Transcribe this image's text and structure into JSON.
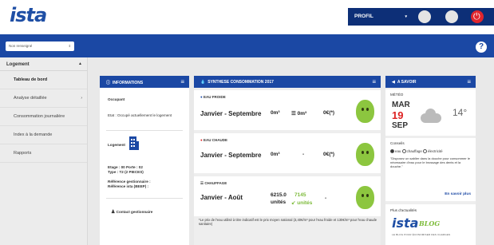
{
  "header": {
    "logo": "ista",
    "profile_label": "PROFIL",
    "profile_caret": "▾"
  },
  "blueband": {
    "select_value": "Non renseigné",
    "help": "?"
  },
  "sidebar": {
    "section": "Logement",
    "items": [
      {
        "label": "Tableau de bord"
      },
      {
        "label": "Analyse détaillée"
      },
      {
        "label": "Consommation journalière"
      },
      {
        "label": "Index à la demande"
      },
      {
        "label": "Rapports"
      }
    ]
  },
  "informations": {
    "title": "INFORMATIONS",
    "occupant_label": "Occupant",
    "etat": "Etat : Occupé actuellement le logement",
    "logement_label": "Logement",
    "etage": "Etage : 00  Porte : 02",
    "type": "Type : T2 (2 PIECES)",
    "ref_gest": "Référence gestionnaire :",
    "ref_ista": "Référence ista (BEEP) :",
    "contact": "Contact gestionnaire"
  },
  "synthese": {
    "title": "SYNTHESE CONSOMMATION 2017",
    "eau_froide": {
      "label": "EAU FROIDE",
      "period": "Janvier - Septembre",
      "value": "0m³",
      "compare": "0m³",
      "cost": "0€(*)"
    },
    "eau_chaude": {
      "label": "EAU CHAUDE",
      "period": "Janvier - Septembre",
      "value": "0m³",
      "compare": "-",
      "cost": "0€(*)"
    },
    "chauffage": {
      "label": "CHAUFFAGE",
      "period": "Janvier - Août",
      "value": "6215.0",
      "unit": "unités",
      "compare": "7145",
      "compare_unit": "unités",
      "cost": "-"
    },
    "note": "*Le prix de l'eau utilisé à titre indicatif est le prix moyen national (3,40€/m³ pour l'eau froide et 130€/m³ pour l'eau chaude sanitaire)"
  },
  "asavoir": {
    "title": "A SAVOIR",
    "meteo_label": "MÉTÉO",
    "day": "MAR",
    "daynum": "19",
    "month": "SEP",
    "temp": "14°",
    "conseils_label": "Conseils",
    "opt1": "eau",
    "opt2": "chauffage",
    "opt3": "électricité",
    "advice": "\"Disposez un sablier dans la douche pour consommer le nécessaire d'eau pour le brossage des dents et la douche.\"",
    "more": "En savoir plus",
    "actualites_label": "Plus d'actualités",
    "blog_logo": "ista",
    "blog_word": "BLOG",
    "blog_sub": "LE BLOG POUR ÉCONOMISER DES CHARGES"
  },
  "colors": {
    "brand": "#1b48a4",
    "dark_brand": "#0d2f77",
    "green": "#8cc63f",
    "red": "#e0262d"
  }
}
